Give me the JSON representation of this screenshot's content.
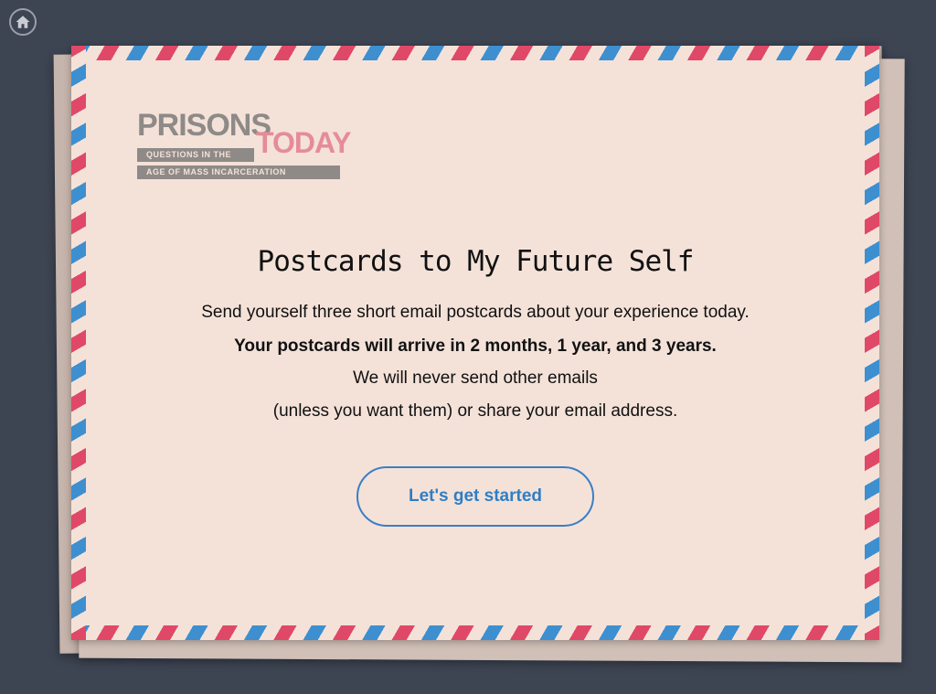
{
  "nav": {
    "home_icon": "home-icon"
  },
  "logo": {
    "word1": "PRISONS",
    "word2": "TODAY",
    "tagline1": "QUESTIONS IN THE",
    "tagline2": "AGE OF MASS INCARCERATION"
  },
  "main": {
    "title": "Postcards to My Future Self",
    "line1": "Send yourself three short email postcards about your experience today.",
    "line2": "Your postcards will arrive in 2 months, 1 year, and 3 years.",
    "line3": "We will never send other emails",
    "line4": "(unless you want them) or share your email address.",
    "start_label": "Let's get started"
  },
  "colors": {
    "background": "#3d4452",
    "envelope": "#f4e2d9",
    "stripe_red": "#e04868",
    "stripe_blue": "#3d8fd0",
    "button_blue": "#2f7ec4"
  }
}
